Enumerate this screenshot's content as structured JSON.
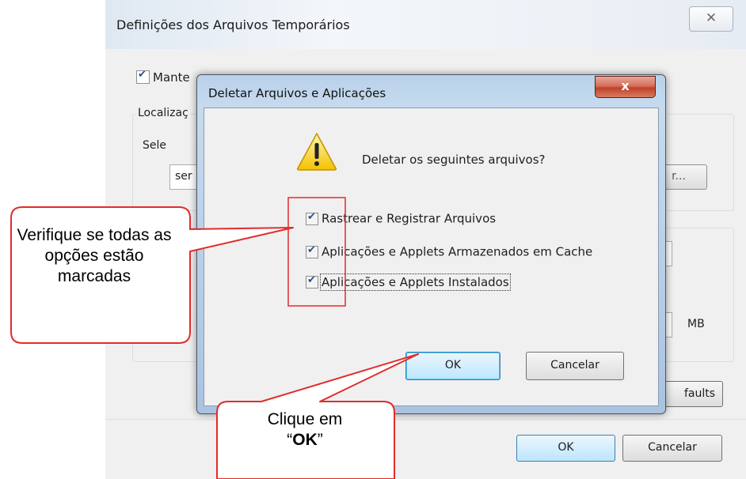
{
  "background_dialog": {
    "title": "Definições dos Arquivos Temporários",
    "close_icon": "✕",
    "keep_files_label": "Mante",
    "location_group_label": "Localizaç",
    "select_label": "Sele",
    "path_value": "ser",
    "browse_label": "r...",
    "size_unit": "MB",
    "restore_defaults_label": "faults",
    "ok_label": "OK",
    "cancel_label": "Cancelar"
  },
  "modal": {
    "title": "Deletar Arquivos e Aplicações",
    "close_icon": "x",
    "question": "Deletar os seguintes arquivos?",
    "options": [
      {
        "label": "Rastrear e Registrar Arquivos",
        "checked": true
      },
      {
        "label": "Aplicações e Applets Armazenados em Cache",
        "checked": true
      },
      {
        "label": "Aplicações e Applets Instalados",
        "checked": true
      }
    ],
    "ok_label": "OK",
    "cancel_label": "Cancelar",
    "icon": "warning-icon"
  },
  "annotations": {
    "callout_1": "Verifique se todas as opções estão marcadas",
    "callout_2_prefix": "Clique em",
    "callout_2_quote_open": "“",
    "callout_2_bold": "OK",
    "callout_2_quote_close": "”",
    "color": "#e32b2b"
  }
}
